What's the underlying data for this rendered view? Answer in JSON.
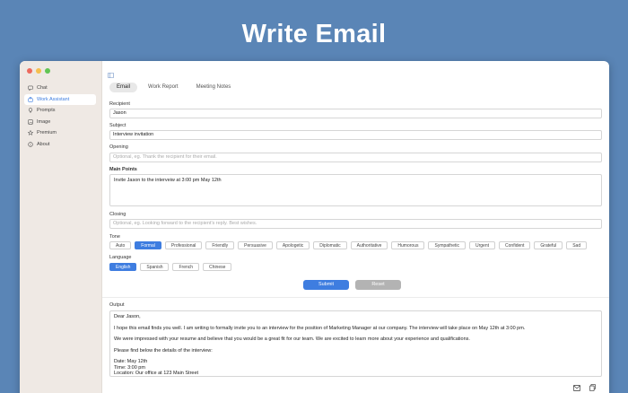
{
  "hero": {
    "title": "Write Email"
  },
  "window": {
    "traffic_colors": [
      "#ed6a5e",
      "#f5bf4f",
      "#61c554"
    ]
  },
  "sidebar": {
    "items": [
      {
        "label": "Chat",
        "icon": "chat-icon",
        "active": false
      },
      {
        "label": "Work Assistant",
        "icon": "briefcase-icon",
        "active": true
      },
      {
        "label": "Prompts",
        "icon": "lightbulb-icon",
        "active": false
      },
      {
        "label": "Image",
        "icon": "image-icon",
        "active": false
      },
      {
        "label": "Premium",
        "icon": "star-icon",
        "active": false
      },
      {
        "label": "About",
        "icon": "info-icon",
        "active": false
      }
    ]
  },
  "tabs": [
    {
      "label": "Email",
      "active": true
    },
    {
      "label": "Work Report",
      "active": false
    },
    {
      "label": "Meeting Notes",
      "active": false
    }
  ],
  "form": {
    "recipient": {
      "label": "Recipient",
      "value": "Jason"
    },
    "subject": {
      "label": "Subject",
      "value": "Interview invitation"
    },
    "opening": {
      "label": "Opening",
      "placeholder": "Optional, eg. Thank the recipient for their email."
    },
    "main_points": {
      "label": "Main Points",
      "value": "Invite Jason to the  interveiw at 3:00 pm May 12th"
    },
    "closing": {
      "label": "Closing",
      "placeholder": "Optional, eg. Looking forward to the recipient's reply. Best wishes."
    },
    "tone": {
      "label": "Tone",
      "options": [
        "Auto",
        "Formal",
        "Professional",
        "Friendly",
        "Persuasive",
        "Apologetic",
        "Diplomatic",
        "Authoritative",
        "Humorous",
        "Sympathetic",
        "Urgent",
        "Confident",
        "Grateful",
        "Sad"
      ],
      "selected": "Formal"
    },
    "language": {
      "label": "Language",
      "options": [
        "English",
        "Spanish",
        "French",
        "Chinese"
      ],
      "selected": "English"
    },
    "submit_label": "Submit",
    "reset_label": "Reset"
  },
  "output": {
    "label": "Output",
    "lines": [
      "Dear Jason,",
      "I hope this email finds you well. I am writing to formally invite you to an interview for the position of Marketing Manager at our company. The interview will take place on May 12th at 3:00 pm.",
      "We were impressed with your resume and believe that you would be a great fit for our team. We are excited to learn more about your experience and qualifications.",
      "Please find below the details of the interview:",
      "Date: May 12th",
      "Time: 3:00 pm",
      "Location: Our office at 123 Main Street"
    ]
  },
  "accent_color": "#3e7de0"
}
